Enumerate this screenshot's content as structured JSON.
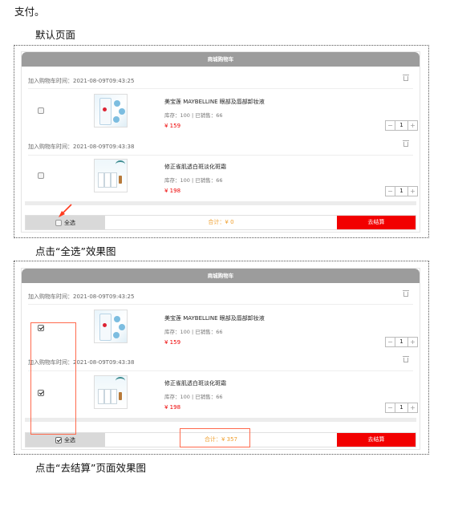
{
  "doc": {
    "top_text": "支付。",
    "caption_default": "默认页面",
    "caption_select_all": "点击“全选”效果图",
    "caption_checkout": "点击“去结算”页面效果图"
  },
  "cart_default": {
    "title": "商城购物车",
    "items": [
      {
        "added_time": "加入购物车时间：2021-08-09T09:43:25",
        "name": "美宝莲 MAYBELLINE 眼部及唇部卸妆液",
        "stock_sales": "库存：100 | 已销售：66",
        "price": "¥ 159",
        "qty": "1",
        "checked": false,
        "icon": "product-makeup-remover-image"
      },
      {
        "added_time": "加入购物车时间：2021-08-09T09:43:38",
        "name": "修正雀肌透白斑淡化斑霜",
        "stock_sales": "库存：100 | 已销售：66",
        "price": "¥ 198",
        "qty": "1",
        "checked": false,
        "icon": "product-skincare-set-image"
      }
    ],
    "select_all_label": "全选",
    "total": "合计：¥ 0",
    "checkout_label": "去结算",
    "stepper_minus": "−",
    "stepper_plus": "+"
  },
  "cart_selected": {
    "title": "商城购物车",
    "items": [
      {
        "added_time": "加入购物车时间：2021-08-09T09:43:25",
        "name": "美宝莲 MAYBELLINE 眼部及唇部卸妆液",
        "stock_sales": "库存：100 | 已销售：66",
        "price": "¥ 159",
        "qty": "1",
        "checked": true
      },
      {
        "added_time": "加入购物车时间：2021-08-09T09:43:38",
        "name": "修正雀肌透白斑淡化斑霜",
        "stock_sales": "库存：100 | 已销售：66",
        "price": "¥ 198",
        "qty": "1",
        "checked": true
      }
    ],
    "select_all_label": "全选",
    "total": "合计：¥ 357",
    "checkout_label": "去结算",
    "stepper_minus": "−",
    "stepper_plus": "+"
  },
  "colors": {
    "header_gray": "#9c9c9c",
    "checkout_red": "#f20000",
    "total_orange": "#f0a030",
    "price_red": "#ee0000",
    "annotation_red": "#ff6a4d"
  }
}
